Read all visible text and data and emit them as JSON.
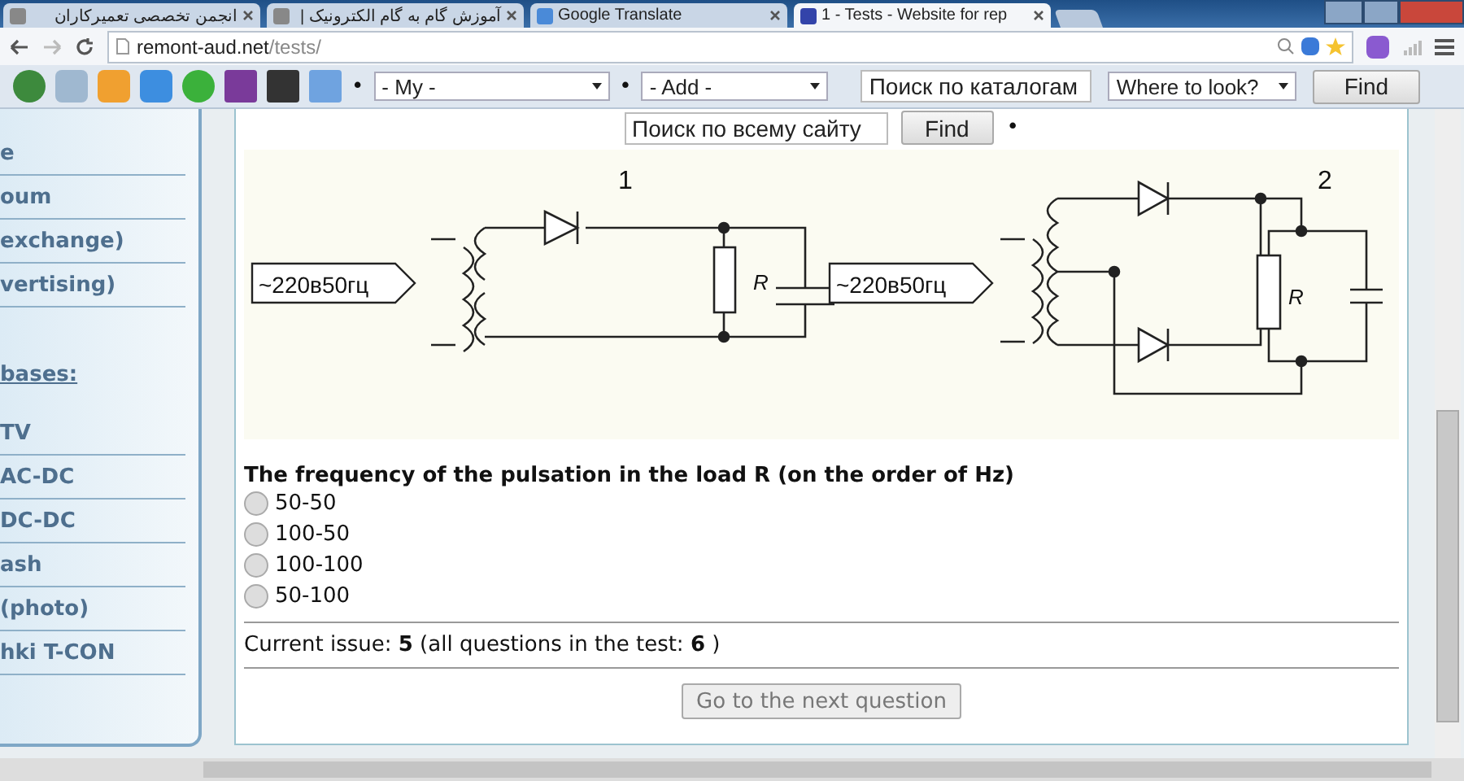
{
  "tabs": [
    {
      "title": "انجمن تخصصی تعمیرکاران",
      "selected": false
    },
    {
      "title": "آموزش گام به گام الکترونیک |",
      "selected": false
    },
    {
      "title": "Google Translate",
      "selected": false
    },
    {
      "title": "1 - Tests - Website for rep",
      "selected": true
    }
  ],
  "address": {
    "host": "remont-aud.net",
    "path": "/tests/"
  },
  "toolbar": [
    {
      "kind": "bullet",
      "text": "•"
    },
    {
      "kind": "select",
      "text": "- My -"
    },
    {
      "kind": "bullet",
      "text": "•"
    },
    {
      "kind": "select",
      "text": "- Add -"
    },
    {
      "kind": "input",
      "text": "Поиск по каталогам"
    },
    {
      "kind": "select",
      "text": "Where to look?"
    },
    {
      "kind": "button",
      "text": "Find"
    }
  ],
  "site_search": {
    "value": "Поиск по всему сайту",
    "button": "Find",
    "bullet": "•"
  },
  "sidebar": {
    "items": [
      {
        "kind": "link",
        "label": "e"
      },
      {
        "kind": "link",
        "label": "oum"
      },
      {
        "kind": "link",
        "label": "exchange)"
      },
      {
        "kind": "link",
        "label": "vertising)"
      },
      {
        "kind": "heading",
        "label": "bases:"
      },
      {
        "kind": "link",
        "label": "TV"
      },
      {
        "kind": "link",
        "label": "AC-DC"
      },
      {
        "kind": "link",
        "label": "DC-DC"
      },
      {
        "kind": "link",
        "label": "ash"
      },
      {
        "kind": "link",
        "label": "(photo)"
      },
      {
        "kind": "link",
        "label": "hki T-CON"
      }
    ]
  },
  "schematic": {
    "circuits": [
      {
        "number": "1",
        "source": "~220в50гц",
        "load": "R"
      },
      {
        "number": "2",
        "source": "~220в50гц",
        "load": "R"
      }
    ]
  },
  "question": {
    "text": "The frequency of the pulsation in the load R (on the order of Hz)",
    "options": [
      {
        "label": "50-50",
        "selected": false
      },
      {
        "label": "100-50",
        "selected": false
      },
      {
        "label": "100-100",
        "selected": false
      },
      {
        "label": "50-100",
        "selected": false
      }
    ]
  },
  "progress": "Current issue: **5** (all questions in the test: **6** )",
  "next_button": {
    "label": "Go to the next question",
    "disabled": true
  }
}
